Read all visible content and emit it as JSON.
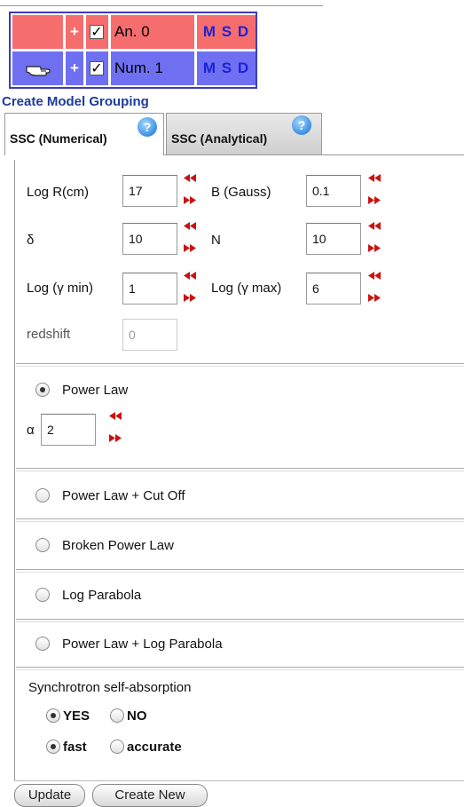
{
  "models": [
    {
      "selected": false,
      "add_label": "+",
      "checked": true,
      "name": "An. 0",
      "msd": "M S D",
      "bg_color": "#f66d6d"
    },
    {
      "selected": true,
      "add_label": "+",
      "checked": true,
      "name": "Num. 1",
      "msd": "M S D",
      "bg_color": "#6f6ff2"
    }
  ],
  "group_title": "Create Model Grouping",
  "tabs": [
    {
      "label": "SSC (Numerical)",
      "help": "?",
      "active": true
    },
    {
      "label": "SSC (Analytical)",
      "help": "?",
      "active": false
    }
  ],
  "params": {
    "log_r": {
      "label": "Log R(cm)",
      "value": "17"
    },
    "b_gauss": {
      "label": "B (Gauss)",
      "value": "0.1"
    },
    "delta": {
      "label": "δ",
      "value": "10"
    },
    "n": {
      "label": "N",
      "value": "10"
    },
    "log_gmin": {
      "label": "Log (γ min)",
      "value": "1"
    },
    "log_gmax": {
      "label": "Log (γ max)",
      "value": "6"
    },
    "redshift": {
      "label": "redshift",
      "value": "0",
      "disabled": true
    }
  },
  "distributions": {
    "power_law": {
      "label": "Power Law",
      "selected": true,
      "alpha_label": "α",
      "alpha_value": "2"
    },
    "power_law_cutoff": {
      "label": "Power Law + Cut Off",
      "selected": false
    },
    "broken_power_law": {
      "label": "Broken Power Law",
      "selected": false
    },
    "log_parabola": {
      "label": "Log Parabola",
      "selected": false
    },
    "power_law_log_parabola": {
      "label": "Power Law + Log Parabola",
      "selected": false
    }
  },
  "ssa": {
    "title": "Synchrotron self-absorption",
    "yes_label": "YES",
    "no_label": "NO",
    "yes_selected": true,
    "fast_label": "fast",
    "accurate_label": "accurate",
    "fast_selected": true
  },
  "buttons": {
    "update": "Update",
    "create_new": "Create New"
  },
  "colors": {
    "arrow": "#cc1111",
    "link": "#1e3a9a",
    "msd": "#1a24d4"
  }
}
